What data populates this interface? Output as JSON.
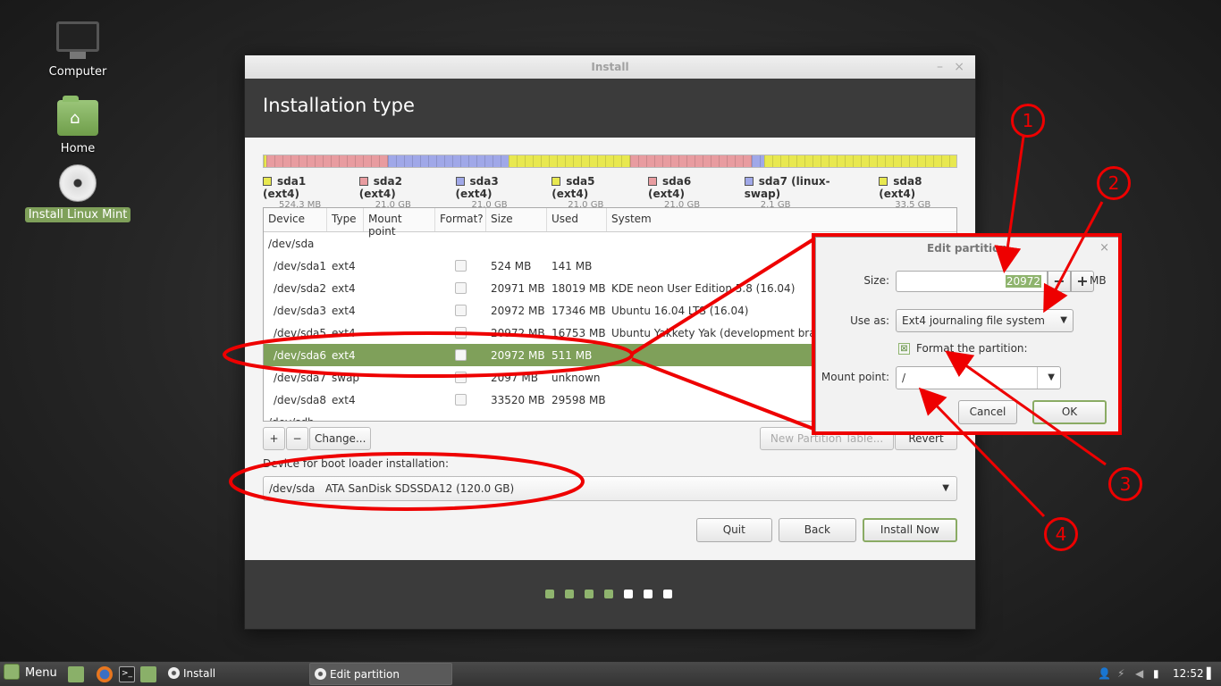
{
  "desktop": {
    "icons": [
      {
        "label": "Computer",
        "icon": "computer-icon"
      },
      {
        "label": "Home",
        "icon": "home-folder-icon"
      },
      {
        "label": "Install Linux Mint",
        "icon": "disc-icon"
      }
    ]
  },
  "window": {
    "title": "Install",
    "minimize_glyph": "–",
    "close_glyph": "×",
    "heading": "Installation type"
  },
  "partitions_bar": [
    {
      "name": "sda1",
      "color": "#e8e850",
      "fraction": 0.004
    },
    {
      "name": "sda2",
      "color": "#e89ca0",
      "fraction": 0.175
    },
    {
      "name": "sda3",
      "color": "#a0a8e8",
      "fraction": 0.175
    },
    {
      "name": "sda5",
      "color": "#e8e850",
      "fraction": 0.175
    },
    {
      "name": "sda6",
      "color": "#e89ca0",
      "fraction": 0.175
    },
    {
      "name": "sda7",
      "color": "#a0a8e8",
      "fraction": 0.018
    },
    {
      "name": "sda8",
      "color": "#e8e850",
      "fraction": 0.278
    }
  ],
  "legend": [
    {
      "name": "sda1 (ext4)",
      "size": "524.3 MB",
      "color": "#e8e850"
    },
    {
      "name": "sda2 (ext4)",
      "size": "21.0 GB",
      "color": "#e89ca0"
    },
    {
      "name": "sda3 (ext4)",
      "size": "21.0 GB",
      "color": "#a0a8e8"
    },
    {
      "name": "sda5 (ext4)",
      "size": "21.0 GB",
      "color": "#e8e850"
    },
    {
      "name": "sda6 (ext4)",
      "size": "21.0 GB",
      "color": "#e89ca0"
    },
    {
      "name": "sda7 (linux-swap)",
      "size": "2.1 GB",
      "color": "#a0a8e8"
    },
    {
      "name": "sda8 (ext4)",
      "size": "33.5 GB",
      "color": "#e8e850"
    }
  ],
  "table": {
    "headers": [
      "Device",
      "Type",
      "Mount point",
      "Format?",
      "Size",
      "Used",
      "System"
    ],
    "group1": "/dev/sda",
    "rows": [
      {
        "device": "/dev/sda1",
        "type": "ext4",
        "mount": "",
        "size": "524 MB",
        "used": "141 MB",
        "system": ""
      },
      {
        "device": "/dev/sda2",
        "type": "ext4",
        "mount": "",
        "size": "20971 MB",
        "used": "18019 MB",
        "system": "KDE neon User Edition 5.8 (16.04)"
      },
      {
        "device": "/dev/sda3",
        "type": "ext4",
        "mount": "",
        "size": "20972 MB",
        "used": "17346 MB",
        "system": "Ubuntu 16.04 LTS (16.04)"
      },
      {
        "device": "/dev/sda5",
        "type": "ext4",
        "mount": "",
        "size": "20972 MB",
        "used": "16753 MB",
        "system": "Ubuntu Yakkety Yak (development branch)"
      },
      {
        "device": "/dev/sda6",
        "type": "ext4",
        "mount": "",
        "size": "20972 MB",
        "used": "511 MB",
        "system": ""
      },
      {
        "device": "/dev/sda7",
        "type": "swap",
        "mount": "",
        "size": "2097 MB",
        "used": "unknown",
        "system": ""
      },
      {
        "device": "/dev/sda8",
        "type": "ext4",
        "mount": "",
        "size": "33520 MB",
        "used": "29598 MB",
        "system": ""
      }
    ],
    "group2": "/dev/sdb",
    "selected_index": 4
  },
  "table_buttons": {
    "add": "+",
    "remove": "−",
    "change": "Change...",
    "new_table": "New Partition Table...",
    "revert": "Revert"
  },
  "boot": {
    "label": "Device for boot loader installation:",
    "value": "/dev/sda   ATA SanDisk SDSSDA12 (120.0 GB)"
  },
  "nav": {
    "quit": "Quit",
    "back": "Back",
    "install": "Install Now"
  },
  "progress": {
    "total_steps": 7,
    "completed_steps": 4
  },
  "dialog": {
    "title": "Edit partition",
    "close_glyph": "×",
    "size_label": "Size:",
    "size_value": "20972",
    "size_unit": "MB",
    "minus": "−",
    "plus": "+",
    "use_as_label": "Use as:",
    "use_as_value": "Ext4 journaling file system",
    "format_label": "Format the partition:",
    "format_checked": true,
    "mount_label": "Mount point:",
    "mount_value": "/",
    "cancel": "Cancel",
    "ok": "OK"
  },
  "annotations": [
    "1",
    "2",
    "3",
    "4"
  ],
  "taskbar": {
    "menu_label": "Menu",
    "tasks": [
      {
        "label": "Install",
        "active": false
      },
      {
        "label": "Edit partition",
        "active": true
      }
    ],
    "clock": "12:52"
  }
}
